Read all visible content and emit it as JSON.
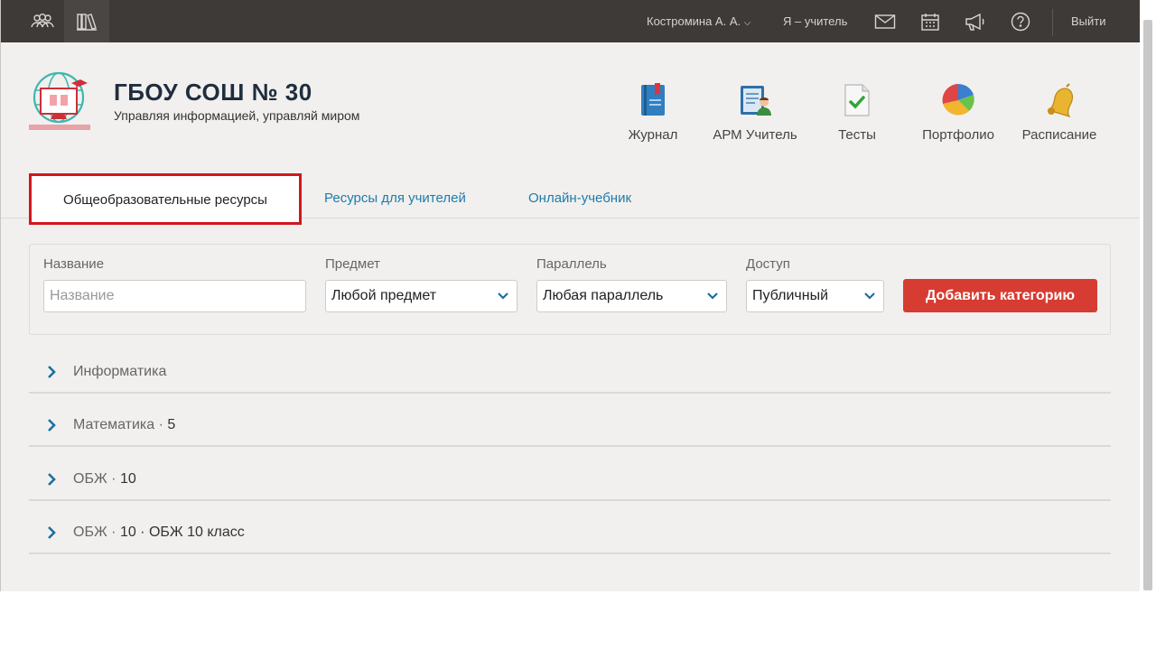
{
  "topbar": {
    "user_name": "Костромина А. А.",
    "role": "Я – учитель",
    "logout": "Выйти",
    "icons": [
      "users-icon",
      "library-icon",
      "mail-icon",
      "calendar-icon",
      "megaphone-icon",
      "help-icon"
    ]
  },
  "header": {
    "school_name": "ГБОУ СОШ № 30",
    "motto": "Управляя информацией, управляй миром",
    "apps": [
      {
        "label": "Журнал",
        "icon": "journal-icon"
      },
      {
        "label": "АРМ Учитель",
        "icon": "teacher-workstation-icon"
      },
      {
        "label": "Тесты",
        "icon": "tests-icon"
      },
      {
        "label": "Портфолио",
        "icon": "portfolio-icon"
      },
      {
        "label": "Расписание",
        "icon": "schedule-bell-icon"
      }
    ]
  },
  "tabs": [
    {
      "label": "Общеобразовательные ресурсы",
      "active": true
    },
    {
      "label": "Ресурсы для учителей",
      "active": false
    },
    {
      "label": "Онлайн-учебник",
      "active": false
    }
  ],
  "filters": {
    "name_label": "Название",
    "name_placeholder": "Название",
    "subject_label": "Предмет",
    "subject_value": "Любой предмет",
    "parallel_label": "Параллель",
    "parallel_value": "Любая параллель",
    "access_label": "Доступ",
    "access_value": "Публичный",
    "add_button": "Добавить категорию"
  },
  "categories": [
    {
      "subject": "Информатика",
      "grade": "",
      "title": ""
    },
    {
      "subject": "Математика · ",
      "grade": "5",
      "title": ""
    },
    {
      "subject": "ОБЖ · ",
      "grade": "10",
      "title": ""
    },
    {
      "subject": "ОБЖ · ",
      "grade": "10",
      "title": " · ОБЖ 10 класс"
    }
  ],
  "colors": {
    "topbar": "#3d3a37",
    "accent_link": "#1c7cad",
    "highlight_border": "#d3161c",
    "add_button": "#d73c33"
  }
}
